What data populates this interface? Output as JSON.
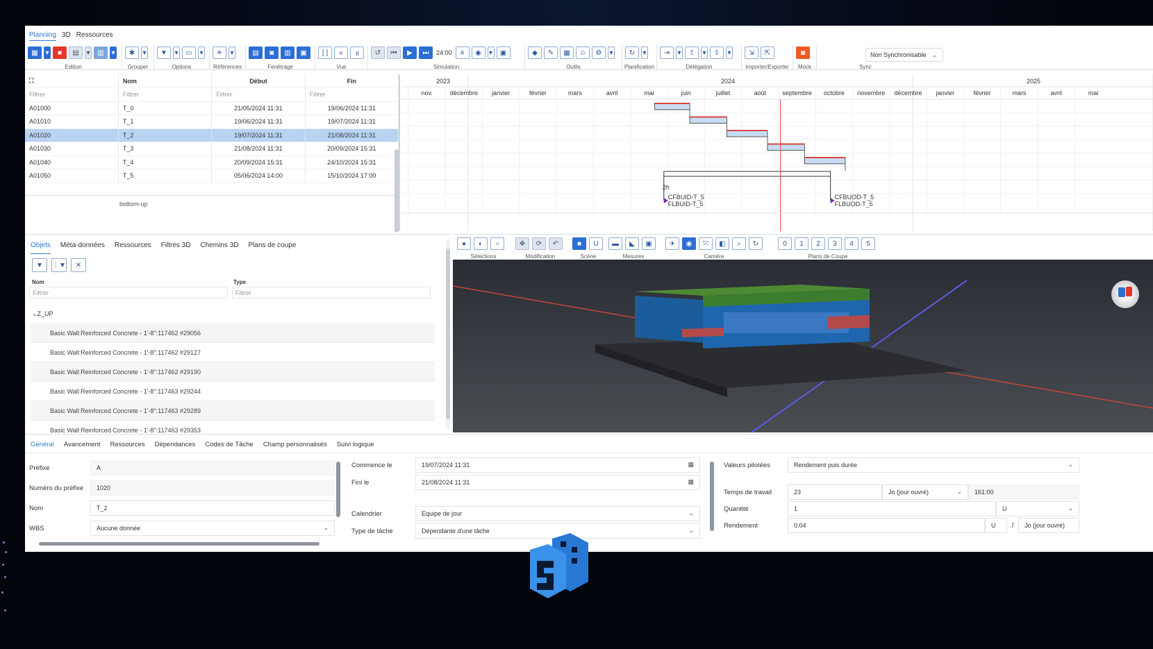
{
  "app_tabs": [
    "Planning",
    "3D",
    "Ressources"
  ],
  "ribbon_groups": [
    "Edition",
    "Grouper",
    "Options",
    "Références",
    "Fenêtrage",
    "Vue",
    "Simulation",
    "Outils",
    "Planification",
    "Délégation",
    "Importer/Exporter",
    "Mock",
    "Sync"
  ],
  "simulation_time": "24:00",
  "sync_select": "Non Synchronisable",
  "grid": {
    "columns": [
      "Nom",
      "Début",
      "Fin"
    ],
    "filter_placeholder": "Filtrer",
    "rows": [
      {
        "id": "A01000",
        "nom": "T_0",
        "debut": "21/05/2024 11:31",
        "fin": "19/06/2024 11:31"
      },
      {
        "id": "A01010",
        "nom": "T_1",
        "debut": "19/06/2024 11:31",
        "fin": "19/07/2024 11:31"
      },
      {
        "id": "A01020",
        "nom": "T_2",
        "debut": "19/07/2024 11:31",
        "fin": "21/08/2024 11:31"
      },
      {
        "id": "A01030",
        "nom": "T_3",
        "debut": "21/08/2024 11:31",
        "fin": "20/09/2024 15:31"
      },
      {
        "id": "A01040",
        "nom": "T_4",
        "debut": "20/09/2024 15:31",
        "fin": "24/10/2024 15:31"
      },
      {
        "id": "A01050",
        "nom": "T_5",
        "debut": "05/06/2024 14:00",
        "fin": "15/10/2024 17:00"
      }
    ],
    "footer": "bottom-up"
  },
  "gantt": {
    "years": [
      "2023",
      "2024",
      "2025"
    ],
    "months": [
      "nov.",
      "décembre",
      "janvier",
      "février",
      "mars",
      "avril",
      "mai",
      "juin",
      "juillet",
      "août",
      "septembre",
      "octobre",
      "novembre",
      "décembre",
      "janvier",
      "février",
      "mars",
      "avril",
      "mai"
    ],
    "milestone_labels": [
      "CFBUID-T_5",
      "FLBUID-T_5",
      "CFBUOD-T_5",
      "FLBUOD-T_5"
    ],
    "duration_label": "2h"
  },
  "objects_panel": {
    "tabs": [
      "Objets",
      "Méta-données",
      "Ressources",
      "Filtres 3D",
      "Chemins 3D",
      "Plans de coupe"
    ],
    "col_name": "Nom",
    "col_type": "Type",
    "filter_placeholder": "Filtrer",
    "root": "Z_UP",
    "items": [
      "Basic Wall:Reinforced Concrete - 1'-8\":117462 #29056",
      "Basic Wall:Reinforced Concrete - 1'-8\":117462 #29127",
      "Basic Wall:Reinforced Concrete - 1'-8\":117462 #29190",
      "Basic Wall:Reinforced Concrete - 1'-8\":117463 #29244",
      "Basic Wall:Reinforced Concrete - 1'-8\":117463 #29289",
      "Basic Wall:Reinforced Concrete - 1'-8\":117463 #29353"
    ]
  },
  "toolbar3d": {
    "groups": [
      "Sélections",
      "Modification",
      "Scène",
      "Mesures",
      "Caméra",
      "Plans de Coupe"
    ],
    "plane_numbers": [
      "0",
      "1",
      "2",
      "3",
      "4",
      "5"
    ]
  },
  "detail_tabs": [
    "Général",
    "Avancement",
    "Ressources",
    "Dépendances",
    "Codes de Tâche",
    "Champ personnalisés",
    "Suivi logique"
  ],
  "general": {
    "prefixe_label": "Préfixe",
    "prefixe": "A",
    "numero_label": "Numéro du préfixe",
    "numero": "1020",
    "nom_label": "Nom",
    "nom": "T_2",
    "wbs_label": "WBS",
    "wbs": "Aucune donnée",
    "commence_label": "Commence le",
    "commence": "19/07/2024 11:31",
    "fini_label": "Fini le",
    "fini": "21/08/2024 11:31",
    "calendrier_label": "Calendrier",
    "calendrier": "Equipe de jour",
    "type_label": "Type de tâche",
    "type": "Dépendante d'une tâche",
    "valeurs_label": "Valeurs pilotées",
    "valeurs": "Rendement puis durée",
    "temps_label": "Temps de travail",
    "temps": "23",
    "temps_unit": "Jo (jour ouvré)",
    "temps_hours": "161:00",
    "quantite_label": "Quantité",
    "quantite": "1",
    "quantite_unit": "U",
    "rendement_label": "Rendement",
    "rendement": "0.04",
    "rendement_unit": "U",
    "rendement_sep": "/",
    "rendement_unit2": "Jo (jour ouvré)"
  }
}
